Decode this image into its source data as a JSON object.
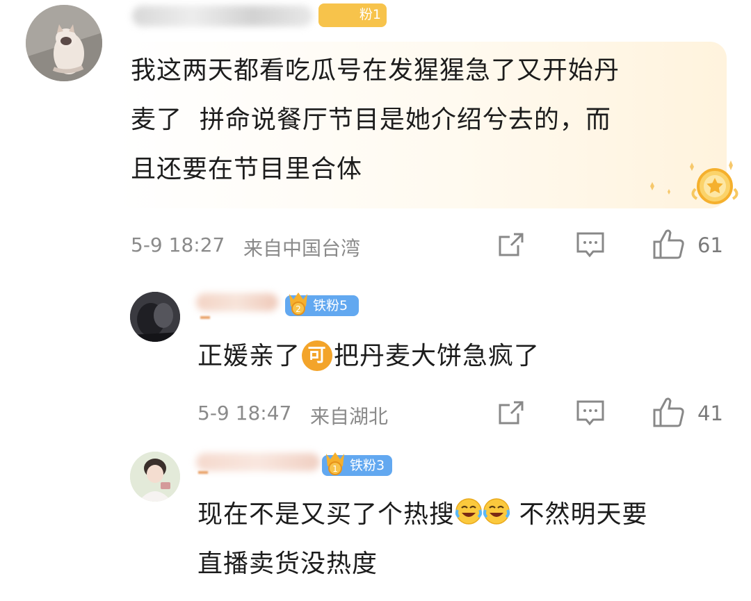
{
  "comments": [
    {
      "badge": "粉1",
      "text_lines": [
        "我这两天都看吃瓜号在发猩猩急了又开始丹",
        "麦了  拼命说餐厅节目是她介绍兮去的，而",
        "且还要在节目里合体"
      ],
      "time": "5-9 18:27",
      "location": "来自中国台湾",
      "likes": "61"
    },
    {
      "badge": "铁粉5",
      "text_before": "正媛亲了",
      "text_emoji": "可",
      "text_after": "把丹麦大饼急疯了",
      "time": "5-9 18:47",
      "location": "来自湖北",
      "likes": "41"
    },
    {
      "badge": "铁粉3",
      "text_line1_before": "现在不是又买了个热搜",
      "text_line1_after": " 不然明天要",
      "text_line2": "直播卖货没热度"
    }
  ],
  "icons": {
    "share": "share-icon",
    "comment": "comment-icon",
    "like": "like-icon",
    "laugh_cry": "laugh-cry-emoji",
    "vip_star": "vip-star-icon"
  },
  "colors": {
    "badge_gold": "#f7b52c",
    "badge_blue": "#62a8f0",
    "meta_gray": "#8a8a8a",
    "highlight_bg": "#fff6e6"
  }
}
